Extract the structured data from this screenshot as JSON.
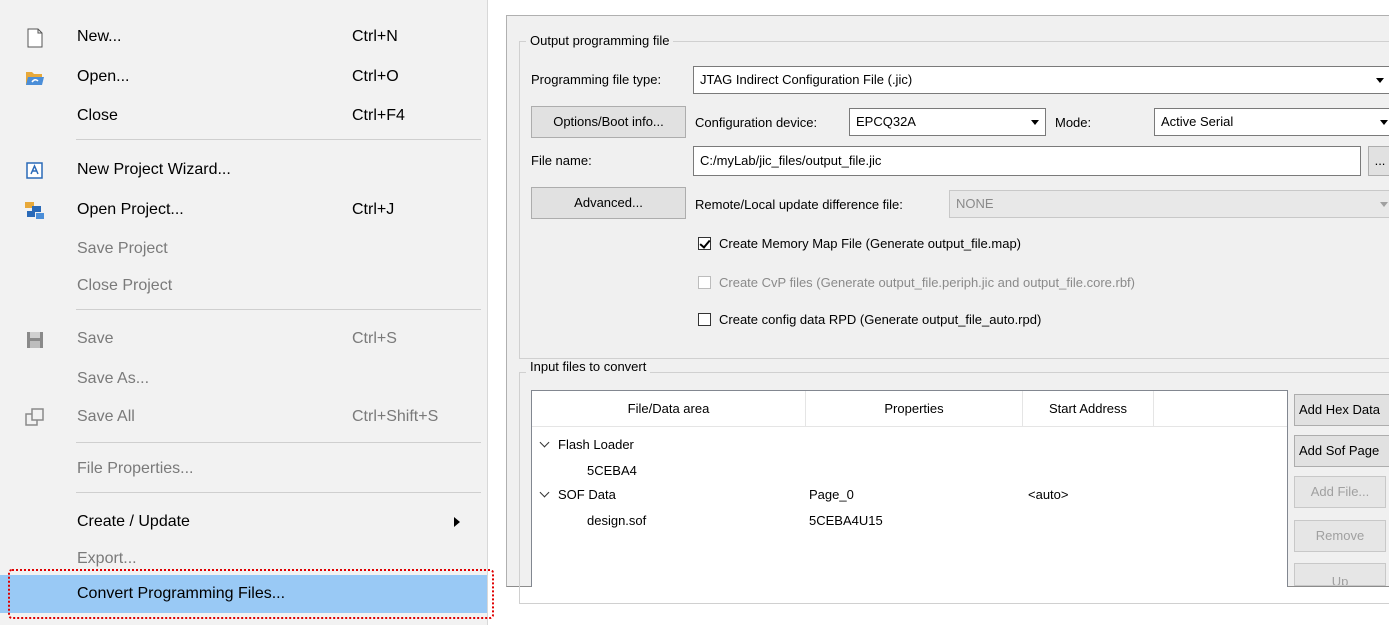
{
  "menu": {
    "items": [
      {
        "label": "New...",
        "shortcut": "Ctrl+N",
        "icon": "new-file-icon"
      },
      {
        "label": "Open...",
        "shortcut": "Ctrl+O",
        "icon": "open-folder-icon"
      },
      {
        "label": "Close",
        "shortcut": "Ctrl+F4"
      },
      {
        "label": "New Project Wizard...",
        "icon": "project-wizard-icon"
      },
      {
        "label": "Open Project...",
        "shortcut": "Ctrl+J",
        "icon": "open-project-icon"
      },
      {
        "label": "Save Project"
      },
      {
        "label": "Close Project"
      },
      {
        "label": "Save",
        "shortcut": "Ctrl+S",
        "icon": "save-icon"
      },
      {
        "label": "Save As..."
      },
      {
        "label": "Save All",
        "shortcut": "Ctrl+Shift+S",
        "icon": "save-all-icon"
      },
      {
        "label": "File Properties..."
      },
      {
        "label": "Create / Update",
        "icon": "submenu-arrow-icon"
      },
      {
        "label": "Export..."
      },
      {
        "label": "Convert Programming Files..."
      }
    ]
  },
  "dialog": {
    "output_group": {
      "title": "Output programming file",
      "file_type_label": "Programming file type:",
      "file_type_value": "JTAG Indirect Configuration File (.jic)",
      "options_button": "Options/Boot info...",
      "config_device_label": "Configuration device:",
      "config_device_value": "EPCQ32A",
      "mode_label": "Mode:",
      "mode_value": "Active Serial",
      "file_name_label": "File name:",
      "file_name_value": "C:/myLab/jic_files/output_file.jic",
      "browse_button": "...",
      "advanced_button": "Advanced...",
      "remote_label": "Remote/Local update difference file:",
      "remote_value": "NONE",
      "checkbox_memory_map": "Create Memory Map File (Generate output_file.map)",
      "checkbox_cvp": "Create CvP files (Generate output_file.periph.jic and output_file.core.rbf)",
      "checkbox_rpd": "Create config data RPD (Generate output_file_auto.rpd)"
    },
    "input_group": {
      "title": "Input files to convert",
      "columns": [
        "File/Data area",
        "Properties",
        "Start Address"
      ],
      "rows": {
        "flash_loader": "Flash Loader",
        "flash_child": "5CEBA4",
        "sof_data": "SOF Data",
        "sof_page": "Page_0",
        "sof_address": "<auto>",
        "sof_child": "design.sof",
        "sof_child_props": "5CEBA4U15"
      },
      "buttons": {
        "add_hex": "Add Hex Data",
        "add_sof_page": "Add Sof Page",
        "add_file": "Add File...",
        "remove": "Remove",
        "up": "Up"
      }
    }
  }
}
